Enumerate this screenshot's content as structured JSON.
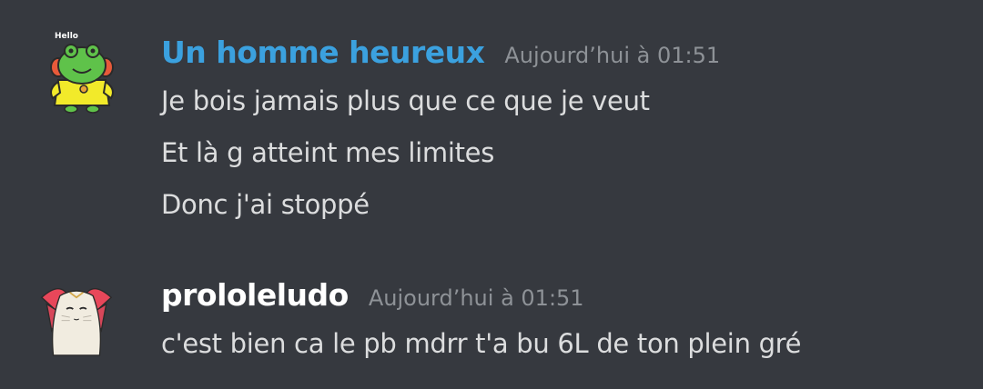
{
  "messages": [
    {
      "author": "Un homme heureux",
      "author_color": "#3ba1df",
      "timestamp": "Aujourd’hui à 01:51",
      "avatar_icon": "frog-hello-icon",
      "avatar_text": "Hello",
      "lines": [
        "Je bois jamais plus que ce que je veut",
        "Et là g atteint mes limites",
        "Donc j'ai stoppé"
      ]
    },
    {
      "author": "prololeludo",
      "author_color": "#ffffff",
      "timestamp": "Aujourd’hui à 01:51",
      "avatar_icon": "anime-cat-icon",
      "lines": [
        "c'est bien ca le pb mdrr t'a bu 6L de ton plein gré"
      ]
    }
  ]
}
